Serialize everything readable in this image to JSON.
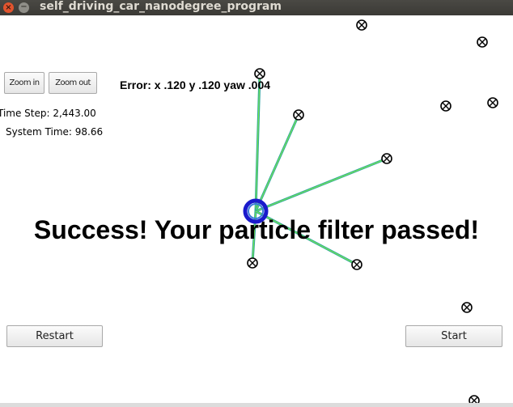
{
  "window": {
    "title": "self_driving_car_nanodegree_program",
    "close_glyph": "×",
    "minimize_glyph": "−"
  },
  "controls": {
    "zoom_in": "Zoom in",
    "zoom_out": "Zoom out",
    "restart": "Restart",
    "start": "Start"
  },
  "stats": {
    "time_step": "Time Step: 2,443.00",
    "system_time": "System Time: 98.66"
  },
  "error_readout": "Error: x .120 y .120 yaw .004",
  "result_message": "Success! Your particle filter passed!",
  "colors": {
    "ray_outer": "#2fa69b",
    "ray_inner": "#7df04a",
    "vehicle_ring": "#1a1acc",
    "vehicle_ring_inner": "#3a7ad8",
    "landmark": "#000000"
  },
  "icons": {
    "landmark": "circled-x-icon",
    "vehicle": "vehicle-ring-icon"
  }
}
